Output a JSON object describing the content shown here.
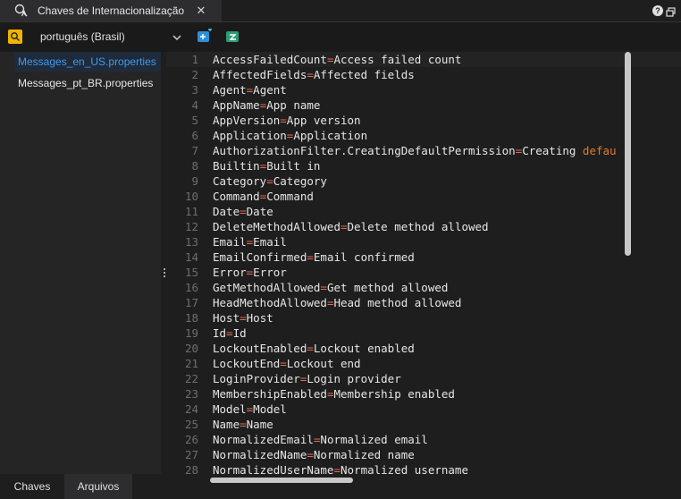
{
  "window": {
    "tab_title": "Chaves de Internacionalização",
    "close_glyph": "✕",
    "help_glyph": "?"
  },
  "toolbar": {
    "language": "português (Brasil)"
  },
  "sidebar": {
    "files": [
      {
        "label": "Messages_en_US.properties",
        "selected": true
      },
      {
        "label": "Messages_pt_BR.properties",
        "selected": false
      }
    ],
    "bottom_tabs": [
      {
        "label": "Chaves",
        "active": false
      },
      {
        "label": "Arquivos",
        "active": true
      }
    ]
  },
  "editor": {
    "lines": [
      {
        "n": "1",
        "key": "AccessFailedCount",
        "value": "Access failed count"
      },
      {
        "n": "2",
        "key": "AffectedFields",
        "value": "Affected fields"
      },
      {
        "n": "3",
        "key": "Agent",
        "value": "Agent"
      },
      {
        "n": "4",
        "key": "AppName",
        "value": "App name"
      },
      {
        "n": "5",
        "key": "AppVersion",
        "value": "App version"
      },
      {
        "n": "6",
        "key": "Application",
        "value": "Application"
      },
      {
        "n": "7",
        "key": "AuthorizationFilter.CreatingDefaultPermission",
        "value": "Creating ",
        "value_tail": "defau"
      },
      {
        "n": "8",
        "key": "Builtin",
        "value": "Built in"
      },
      {
        "n": "9",
        "key": "Category",
        "value": "Category"
      },
      {
        "n": "10",
        "key": "Command",
        "value": "Command"
      },
      {
        "n": "11",
        "key": "Date",
        "value": "Date"
      },
      {
        "n": "12",
        "key": "DeleteMethodAllowed",
        "value": "Delete method allowed"
      },
      {
        "n": "13",
        "key": "Email",
        "value": "Email"
      },
      {
        "n": "14",
        "key": "EmailConfirmed",
        "value": "Email confirmed"
      },
      {
        "n": "15",
        "key": "Error",
        "value": "Error"
      },
      {
        "n": "16",
        "key": "GetMethodAllowed",
        "value": "Get method allowed"
      },
      {
        "n": "17",
        "key": "HeadMethodAllowed",
        "value": "Head method allowed"
      },
      {
        "n": "18",
        "key": "Host",
        "value": "Host"
      },
      {
        "n": "19",
        "key": "Id",
        "value": "Id"
      },
      {
        "n": "20",
        "key": "LockoutEnabled",
        "value": "Lockout enabled"
      },
      {
        "n": "21",
        "key": "LockoutEnd",
        "value": "Lockout end"
      },
      {
        "n": "22",
        "key": "LoginProvider",
        "value": "Login provider"
      },
      {
        "n": "23",
        "key": "MembershipEnabled",
        "value": "Membership enabled"
      },
      {
        "n": "24",
        "key": "Model",
        "value": "Model"
      },
      {
        "n": "25",
        "key": "Name",
        "value": "Name"
      },
      {
        "n": "26",
        "key": "NormalizedEmail",
        "value": "Normalized email"
      },
      {
        "n": "27",
        "key": "NormalizedName",
        "value": "Normalized name"
      },
      {
        "n": "28",
        "key": "NormalizedUserName",
        "value": "Normalized username"
      }
    ]
  },
  "colors": {
    "accent_blue": "#3c9df0",
    "equals_sign": "#e06c55",
    "highlight_word": "#e07b30",
    "lang_icon": "#f0b400"
  },
  "icons": {
    "tab": "translate-icon",
    "language": "language-badge-icon",
    "chevron": "chevron-down-icon",
    "add_key": "add-key-icon",
    "translate_key": "translate-key-icon",
    "help": "help-icon",
    "restore": "restore-icon"
  }
}
